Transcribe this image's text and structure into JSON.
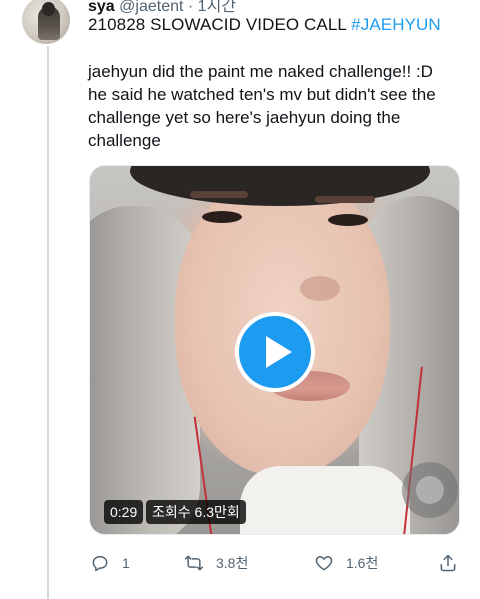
{
  "tweet": {
    "author_name": "sya",
    "author_handle": "@jaetent",
    "time": "· 1시간",
    "subject_prefix": "210828 SLOWACID VIDEO CALL ",
    "subject_hashtag": "#JAEHYUN",
    "body_lines": [
      "jaehyun did the paint me naked challenge!! :D",
      "he said he watched ten's mv but didn't see the",
      "challenge yet so here's jaehyun doing the",
      "challenge"
    ]
  },
  "video": {
    "duration": "0:29",
    "views": "조회수 6.3만회",
    "play_icon": "play-icon"
  },
  "actions": {
    "reply_count": "1",
    "retweet_count": "3.8천",
    "like_count": "1.6천",
    "icons": [
      "reply-icon",
      "retweet-icon",
      "like-icon",
      "share-icon"
    ]
  },
  "colors": {
    "accent": "#1d9bf0",
    "text": "#0f1419",
    "muted": "#536471"
  }
}
